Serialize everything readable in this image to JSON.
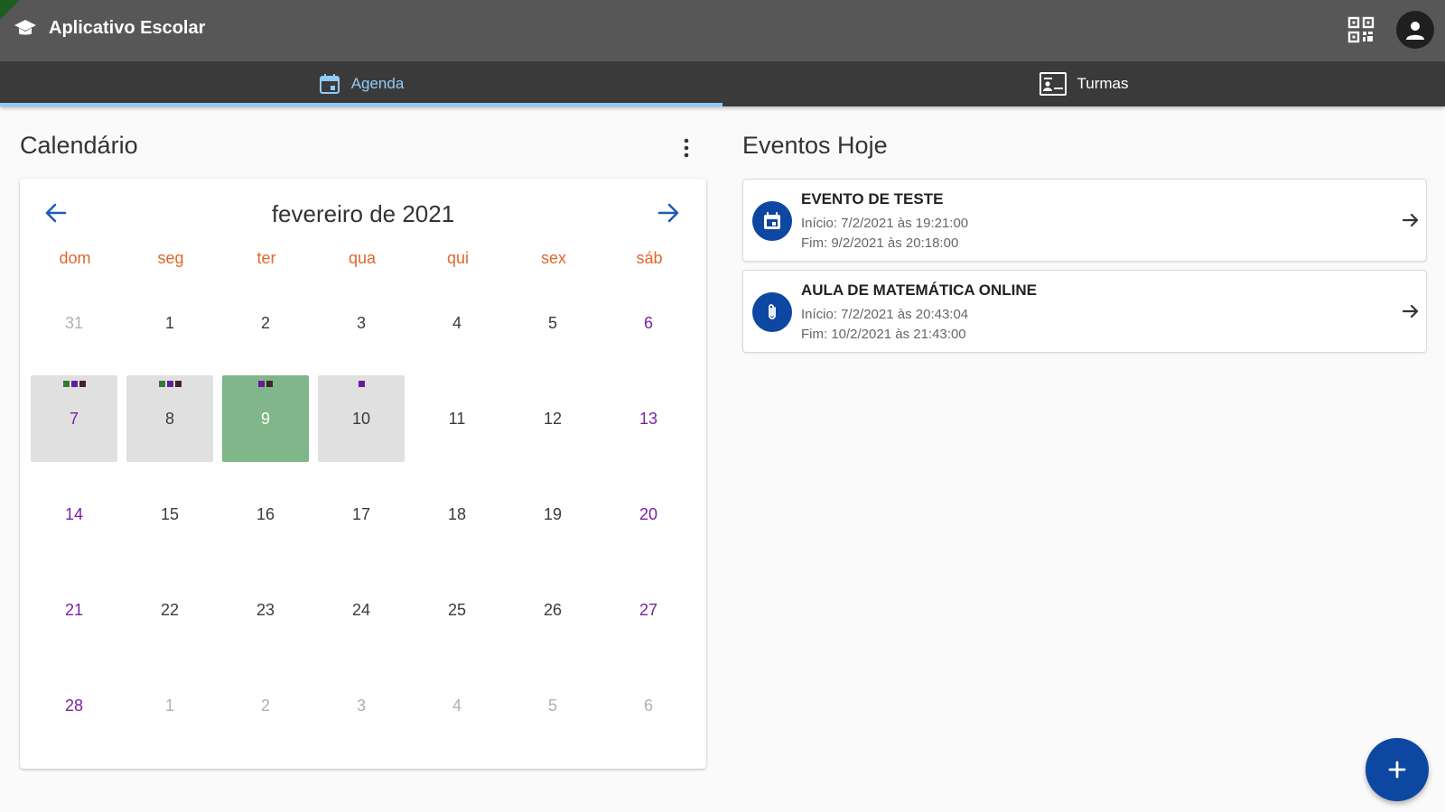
{
  "app": {
    "title": "Aplicativo Escolar",
    "logo_icon": "school-cap-icon",
    "qr_icon": "qr-code-icon",
    "account_icon": "account-icon"
  },
  "tabs": [
    {
      "label": "Agenda",
      "icon": "calendar-icon",
      "active": true
    },
    {
      "label": "Turmas",
      "icon": "class-board-icon",
      "active": false
    }
  ],
  "calendar": {
    "section_title": "Calendário",
    "month_title": "fevereiro de 2021",
    "weekdays": [
      "dom",
      "seg",
      "ter",
      "qua",
      "qui",
      "sex",
      "sáb"
    ],
    "weeks": [
      [
        {
          "d": "31",
          "muted": true
        },
        {
          "d": "1"
        },
        {
          "d": "2"
        },
        {
          "d": "3"
        },
        {
          "d": "4"
        },
        {
          "d": "5"
        },
        {
          "d": "6"
        }
      ],
      [
        {
          "d": "7",
          "events": [
            "#2e7d32",
            "#6a1b9a",
            "#3e2723"
          ]
        },
        {
          "d": "8",
          "events": [
            "#2e7d32",
            "#6a1b9a",
            "#3e2723"
          ]
        },
        {
          "d": "9",
          "selected": true,
          "events": [
            "#6a1b9a",
            "#3e2723"
          ]
        },
        {
          "d": "10",
          "events": [
            "#6a1b9a"
          ]
        },
        {
          "d": "11"
        },
        {
          "d": "12"
        },
        {
          "d": "13"
        }
      ],
      [
        {
          "d": "14"
        },
        {
          "d": "15"
        },
        {
          "d": "16"
        },
        {
          "d": "17"
        },
        {
          "d": "18"
        },
        {
          "d": "19"
        },
        {
          "d": "20"
        }
      ],
      [
        {
          "d": "21"
        },
        {
          "d": "22"
        },
        {
          "d": "23"
        },
        {
          "d": "24"
        },
        {
          "d": "25"
        },
        {
          "d": "26"
        },
        {
          "d": "27"
        }
      ],
      [
        {
          "d": "28"
        },
        {
          "d": "1",
          "muted": true
        },
        {
          "d": "2",
          "muted": true
        },
        {
          "d": "3",
          "muted": true
        },
        {
          "d": "4",
          "muted": true
        },
        {
          "d": "5",
          "muted": true
        },
        {
          "d": "6",
          "muted": true
        }
      ]
    ],
    "selected_color": "#81b58a",
    "event_day_color": "#e0e0e0"
  },
  "today": {
    "section_title": "Eventos Hoje",
    "events": [
      {
        "title": "EVENTO DE TESTE",
        "start": "Início: 7/2/2021 às 19:21:00",
        "end": "Fim: 9/2/2021 às 20:18:00",
        "icon": "event-calendar-icon"
      },
      {
        "title": "AULA DE MATEMÁTICA ONLINE",
        "start": "Início: 7/2/2021 às 20:43:04",
        "end": "Fim: 10/2/2021 às 21:43:00",
        "icon": "paperclip-icon"
      }
    ]
  },
  "fab": {
    "icon": "plus-icon"
  },
  "colors": {
    "accent": "#0d47a1",
    "tab_active": "#90caf9",
    "weekday": "#e0662e",
    "weekend": "#7b1fa2"
  }
}
